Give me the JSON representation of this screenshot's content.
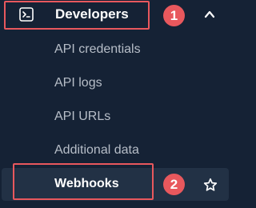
{
  "menu": {
    "parent": {
      "label": "Developers",
      "icon": "terminal-icon",
      "expanded": true
    },
    "items": [
      {
        "label": "API credentials"
      },
      {
        "label": "API logs"
      },
      {
        "label": "API URLs"
      },
      {
        "label": "Additional data"
      },
      {
        "label": "Webhooks",
        "active": true,
        "icon": "star-icon"
      }
    ]
  },
  "annotations": {
    "step1": "1",
    "step2": "2",
    "highlight_color": "#e8585d"
  },
  "colors": {
    "background": "#152235",
    "active_row": "#223145",
    "text_primary": "#ffffff",
    "text_secondary": "#b7bec8"
  }
}
